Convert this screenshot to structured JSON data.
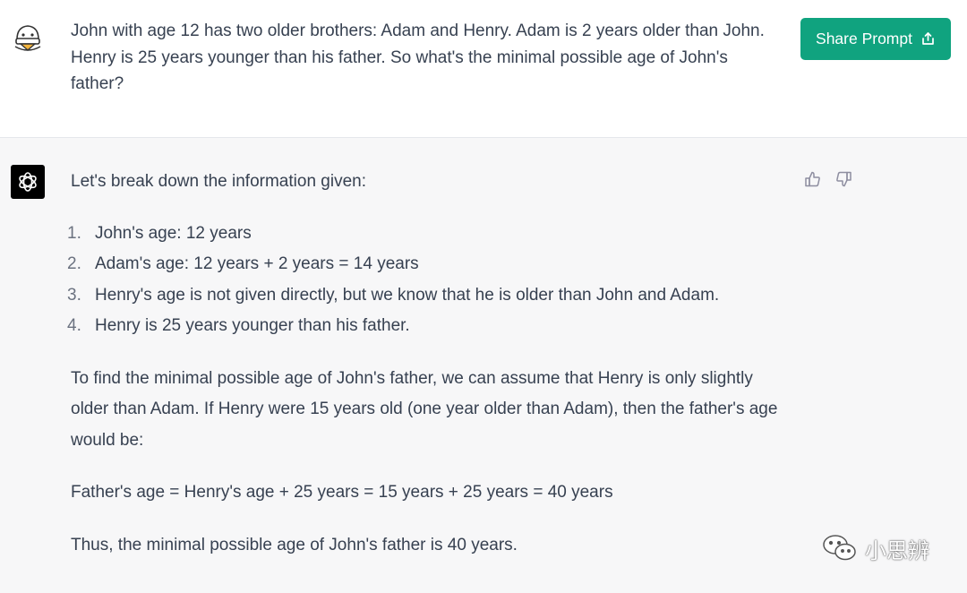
{
  "user_message": {
    "text": "John with age 12 has two older brothers: Adam and Henry. Adam is 2 years older than John. Henry is 25 years younger than his father. So what's the minimal possible age of John's father?",
    "avatar_icon": "duck-avatar-icon"
  },
  "header": {
    "share_label": "Share Prompt",
    "share_icon": "share-icon",
    "accent_color": "#10a37f"
  },
  "assistant_message": {
    "avatar_icon": "openai-logo-icon",
    "intro": "Let's break down the information given:",
    "list": [
      {
        "num": "1.",
        "text": "John's age: 12 years"
      },
      {
        "num": "2.",
        "text": "Adam's age: 12 years + 2 years = 14 years"
      },
      {
        "num": "3.",
        "text": "Henry's age is not given directly, but we know that he is older than John and Adam."
      },
      {
        "num": "4.",
        "text": "Henry is 25 years younger than his father."
      }
    ],
    "paragraph1": "To find the minimal possible age of John's father, we can assume that Henry is only slightly older than Adam. If Henry were 15 years old (one year older than Adam), then the father's age would be:",
    "paragraph2": "Father's age = Henry's age + 25 years = 15 years + 25 years = 40 years",
    "paragraph3": "Thus, the minimal possible age of John's father is 40 years."
  },
  "feedback": {
    "up_icon": "thumbs-up-icon",
    "down_icon": "thumbs-down-icon"
  },
  "watermark": {
    "text": "小思辨",
    "icon": "wechat-icon"
  }
}
